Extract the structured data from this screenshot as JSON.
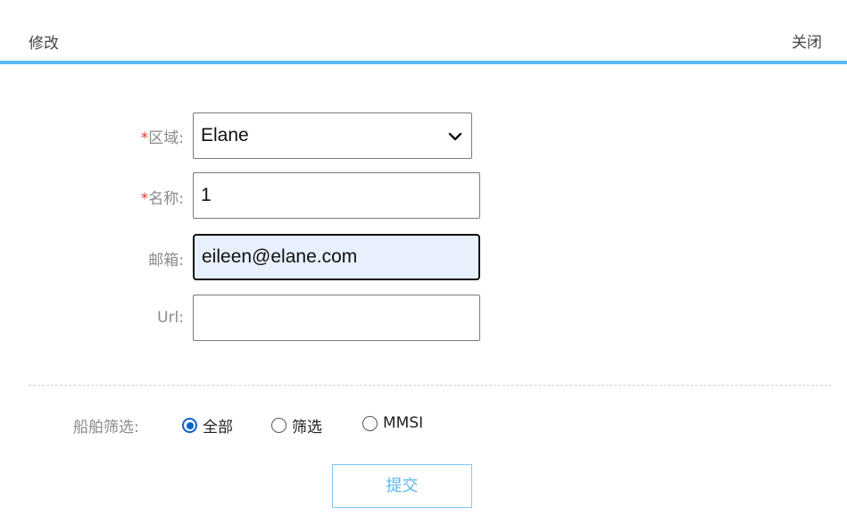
{
  "header": {
    "title": "修改",
    "close_label": "关闭"
  },
  "form": {
    "region": {
      "required_mark": "*",
      "label": "区域:",
      "selected": "Elane"
    },
    "name": {
      "required_mark": "*",
      "label": "名称:",
      "value": "1"
    },
    "email": {
      "label": "邮箱:",
      "value": "eileen@elane.com"
    },
    "url": {
      "label": "Url:",
      "value": ""
    }
  },
  "ship_filter": {
    "label": "船舶筛选:",
    "options": [
      {
        "label": "全部",
        "checked": true
      },
      {
        "label": "筛选",
        "checked": false
      },
      {
        "label": "MMSI",
        "checked": false
      }
    ]
  },
  "submit_label": "提交",
  "colors": {
    "accent": "#5bb8f0",
    "required": "#e03b3b",
    "radio_checked": "#0b63ce",
    "autofill_bg": "#e8f0fe"
  }
}
